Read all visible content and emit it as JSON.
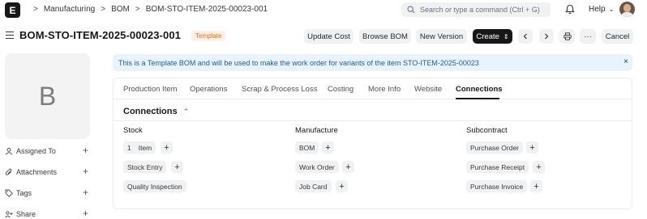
{
  "navbar": {
    "logo_letter": "E",
    "breadcrumbs": [
      "Manufacturing",
      "BOM",
      "BOM-STO-ITEM-2025-00023-001"
    ],
    "breadcrumb_separator": ">",
    "search_placeholder": "Search or type a command (Ctrl + G)",
    "help_label": "Help"
  },
  "header": {
    "title": "BOM-STO-ITEM-2025-00023-001",
    "status_badge": "Template",
    "buttons": {
      "update_cost": "Update Cost",
      "browse_bom": "Browse BOM",
      "new_version": "New Version",
      "create": "Create",
      "more": "···",
      "cancel": "Cancel"
    }
  },
  "sidebar": {
    "image_initial": "B",
    "items": [
      {
        "label": "Assigned To",
        "icon": "user-icon"
      },
      {
        "label": "Attachments",
        "icon": "paperclip-icon"
      },
      {
        "label": "Tags",
        "icon": "tag-icon"
      },
      {
        "label": "Share",
        "icon": "share-icon"
      }
    ]
  },
  "alert": {
    "message": "This is a Template BOM and will be used to make the work order for variants of the item STO-ITEM-2025-00023",
    "close": "×"
  },
  "tabs": [
    "Production Item",
    "Operations",
    "Scrap & Process Loss",
    "Costing",
    "More Info",
    "Website",
    "Connections"
  ],
  "active_tab": "Connections",
  "connections": {
    "title": "Connections",
    "groups": [
      {
        "heading": "Stock",
        "links": [
          {
            "label": "Item",
            "count": "1"
          },
          {
            "label": "Stock Entry"
          },
          {
            "label": "Quality Inspection"
          }
        ]
      },
      {
        "heading": "Manufacture",
        "links": [
          {
            "label": "BOM"
          },
          {
            "label": "Work Order"
          },
          {
            "label": "Job Card"
          }
        ]
      },
      {
        "heading": "Subcontract",
        "links": [
          {
            "label": "Purchase Order"
          },
          {
            "label": "Purchase Receipt"
          },
          {
            "label": "Purchase Invoice"
          }
        ]
      }
    ]
  },
  "colors": {
    "primary_dark": "#171717",
    "badge_text": "#e86c13",
    "badge_bg": "#fff1e7",
    "alert_bg": "#e8f3fd",
    "alert_text": "#1f5c99"
  }
}
